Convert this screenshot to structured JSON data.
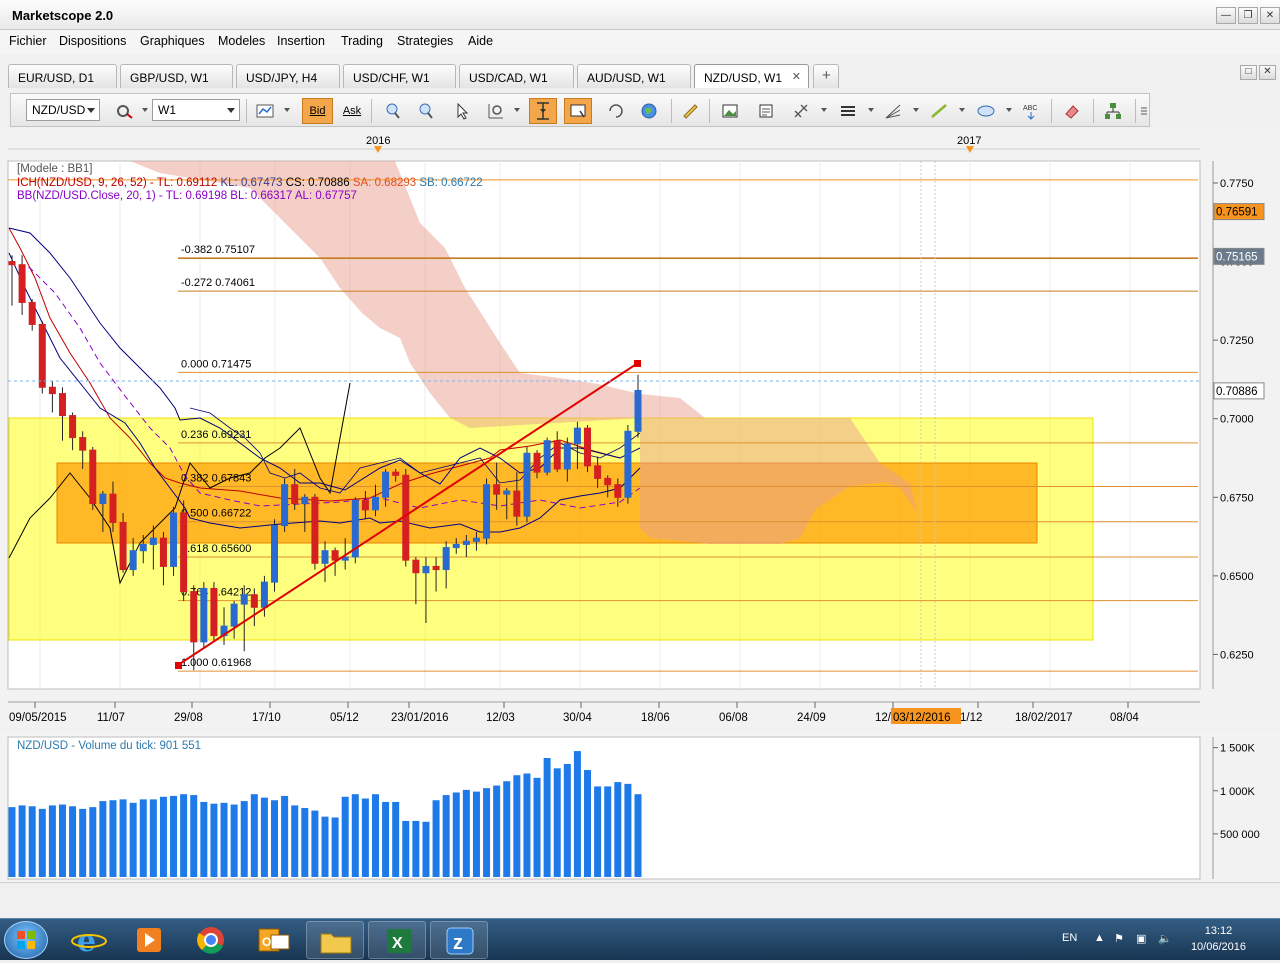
{
  "app": {
    "title": "Marketscope 2.0"
  },
  "menu": [
    "Fichier",
    "Dispositions",
    "Graphiques",
    "Modeles",
    "Insertion",
    "Trading",
    "Strategies",
    "Aide"
  ],
  "tabs": [
    "EUR/USD, D1",
    "GBP/USD, W1",
    "USD/JPY, H4",
    "USD/CHF, W1",
    "USD/CAD, W1",
    "AUD/USD, W1",
    "NZD/USD, W1"
  ],
  "active_tab": "NZD/USD, W1",
  "toolbar": {
    "symbol": "NZD/USD",
    "timeframe": "W1",
    "bid": "Bid",
    "ask": "Ask"
  },
  "chart": {
    "years": [
      "2016",
      "2017"
    ],
    "legend": {
      "model": "[Modele : BB1]",
      "ich": "ICH(NZD/USD, 9, 26, 52) -",
      "ich_tl": "TL: 0.69112",
      "ich_kl": "KL: 0.67473",
      "ich_cs": "CS: 0.70886",
      "ich_sa": "SA: 0.68293",
      "ich_sb": "SB: 0.66722",
      "bb": "BB(NZD/USD.Close, 20, 1) -",
      "bb_tl": "TL: 0.69198",
      "bb_bl": "BL: 0.66317",
      "bb_al": "AL: 0.67757"
    },
    "price_ticks": [
      "0.7750",
      "0.7500",
      "0.7250",
      "0.7000",
      "0.6750",
      "0.6500",
      "0.6250"
    ],
    "price_markers": [
      {
        "label": "0.76591",
        "bg": "#f7941d"
      },
      {
        "label": "0.75165",
        "bg": "#6b7b8b"
      },
      {
        "label": "0.70886",
        "bg": "#ffffff"
      }
    ],
    "fib_levels": [
      "-0.382 0.75107",
      "-0.272 0.74061",
      "0.000 0.71475",
      "0.236 0.69231",
      "0.382 0.67843",
      "0.500 0.66722",
      "0.618 0.65600",
      "0.764 0.64212",
      "1.000 0.61968"
    ],
    "date_ticks": [
      "09/05/2015",
      "11/07",
      "29/08",
      "17/10",
      "05/12",
      "23/01/2016",
      "12/03",
      "30/04",
      "18/06",
      "06/08",
      "24/09",
      "12/",
      "1/12",
      "18/02/2017",
      "08/04"
    ],
    "crosshair_date": "03/12/2016"
  },
  "volume": {
    "title": "NZD/USD - Volume du tick: 901 551",
    "ticks": [
      "1 500K",
      "1 000K",
      "500 000"
    ]
  },
  "chart_data": {
    "type": "candlestick",
    "symbol": "NZD/USD",
    "timeframe": "W1",
    "ylim": [
      0.614,
      0.782
    ],
    "candles": [
      {
        "o": 0.75,
        "h": 0.752,
        "l": 0.736,
        "c": 0.749
      },
      {
        "o": 0.749,
        "h": 0.752,
        "l": 0.733,
        "c": 0.737
      },
      {
        "o": 0.737,
        "h": 0.738,
        "l": 0.728,
        "c": 0.73
      },
      {
        "o": 0.73,
        "h": 0.731,
        "l": 0.708,
        "c": 0.71
      },
      {
        "o": 0.71,
        "h": 0.712,
        "l": 0.702,
        "c": 0.708
      },
      {
        "o": 0.708,
        "h": 0.71,
        "l": 0.693,
        "c": 0.701
      },
      {
        "o": 0.701,
        "h": 0.702,
        "l": 0.69,
        "c": 0.694
      },
      {
        "o": 0.694,
        "h": 0.696,
        "l": 0.684,
        "c": 0.69
      },
      {
        "o": 0.69,
        "h": 0.691,
        "l": 0.671,
        "c": 0.673
      },
      {
        "o": 0.673,
        "h": 0.677,
        "l": 0.664,
        "c": 0.676
      },
      {
        "o": 0.676,
        "h": 0.68,
        "l": 0.664,
        "c": 0.667
      },
      {
        "o": 0.667,
        "h": 0.67,
        "l": 0.651,
        "c": 0.652
      },
      {
        "o": 0.652,
        "h": 0.662,
        "l": 0.65,
        "c": 0.658
      },
      {
        "o": 0.658,
        "h": 0.663,
        "l": 0.654,
        "c": 0.66
      },
      {
        "o": 0.66,
        "h": 0.666,
        "l": 0.652,
        "c": 0.662
      },
      {
        "o": 0.662,
        "h": 0.664,
        "l": 0.647,
        "c": 0.653
      },
      {
        "o": 0.653,
        "h": 0.672,
        "l": 0.65,
        "c": 0.67
      },
      {
        "o": 0.67,
        "h": 0.674,
        "l": 0.642,
        "c": 0.645
      },
      {
        "o": 0.645,
        "h": 0.647,
        "l": 0.62,
        "c": 0.629
      },
      {
        "o": 0.629,
        "h": 0.648,
        "l": 0.627,
        "c": 0.646
      },
      {
        "o": 0.646,
        "h": 0.648,
        "l": 0.629,
        "c": 0.631
      },
      {
        "o": 0.631,
        "h": 0.64,
        "l": 0.628,
        "c": 0.634
      },
      {
        "o": 0.634,
        "h": 0.642,
        "l": 0.63,
        "c": 0.641
      },
      {
        "o": 0.641,
        "h": 0.647,
        "l": 0.626,
        "c": 0.644
      },
      {
        "o": 0.644,
        "h": 0.646,
        "l": 0.634,
        "c": 0.64
      },
      {
        "o": 0.64,
        "h": 0.65,
        "l": 0.637,
        "c": 0.648
      },
      {
        "o": 0.648,
        "h": 0.668,
        "l": 0.645,
        "c": 0.666
      },
      {
        "o": 0.666,
        "h": 0.681,
        "l": 0.664,
        "c": 0.679
      },
      {
        "o": 0.679,
        "h": 0.684,
        "l": 0.671,
        "c": 0.673
      },
      {
        "o": 0.673,
        "h": 0.676,
        "l": 0.664,
        "c": 0.675
      },
      {
        "o": 0.675,
        "h": 0.676,
        "l": 0.652,
        "c": 0.654
      },
      {
        "o": 0.654,
        "h": 0.661,
        "l": 0.648,
        "c": 0.658
      },
      {
        "o": 0.658,
        "h": 0.659,
        "l": 0.65,
        "c": 0.655
      },
      {
        "o": 0.655,
        "h": 0.662,
        "l": 0.652,
        "c": 0.656
      },
      {
        "o": 0.656,
        "h": 0.675,
        "l": 0.654,
        "c": 0.674
      },
      {
        "o": 0.674,
        "h": 0.677,
        "l": 0.668,
        "c": 0.671
      },
      {
        "o": 0.671,
        "h": 0.679,
        "l": 0.669,
        "c": 0.675
      },
      {
        "o": 0.675,
        "h": 0.684,
        "l": 0.672,
        "c": 0.683
      },
      {
        "o": 0.683,
        "h": 0.684,
        "l": 0.68,
        "c": 0.682
      },
      {
        "o": 0.682,
        "h": 0.684,
        "l": 0.653,
        "c": 0.655
      },
      {
        "o": 0.655,
        "h": 0.656,
        "l": 0.641,
        "c": 0.651
      },
      {
        "o": 0.651,
        "h": 0.656,
        "l": 0.635,
        "c": 0.653
      },
      {
        "o": 0.653,
        "h": 0.656,
        "l": 0.645,
        "c": 0.652
      },
      {
        "o": 0.652,
        "h": 0.661,
        "l": 0.646,
        "c": 0.659
      },
      {
        "o": 0.659,
        "h": 0.662,
        "l": 0.657,
        "c": 0.66
      },
      {
        "o": 0.66,
        "h": 0.663,
        "l": 0.656,
        "c": 0.661
      },
      {
        "o": 0.661,
        "h": 0.664,
        "l": 0.658,
        "c": 0.662
      },
      {
        "o": 0.662,
        "h": 0.681,
        "l": 0.66,
        "c": 0.679
      },
      {
        "o": 0.679,
        "h": 0.686,
        "l": 0.671,
        "c": 0.676
      },
      {
        "o": 0.676,
        "h": 0.678,
        "l": 0.668,
        "c": 0.677
      },
      {
        "o": 0.677,
        "h": 0.683,
        "l": 0.666,
        "c": 0.669
      },
      {
        "o": 0.669,
        "h": 0.691,
        "l": 0.667,
        "c": 0.689
      },
      {
        "o": 0.689,
        "h": 0.69,
        "l": 0.681,
        "c": 0.683
      },
      {
        "o": 0.683,
        "h": 0.694,
        "l": 0.682,
        "c": 0.693
      },
      {
        "o": 0.693,
        "h": 0.696,
        "l": 0.683,
        "c": 0.684
      },
      {
        "o": 0.684,
        "h": 0.694,
        "l": 0.68,
        "c": 0.692
      },
      {
        "o": 0.692,
        "h": 0.699,
        "l": 0.684,
        "c": 0.697
      },
      {
        "o": 0.697,
        "h": 0.698,
        "l": 0.683,
        "c": 0.685
      },
      {
        "o": 0.685,
        "h": 0.688,
        "l": 0.678,
        "c": 0.681
      },
      {
        "o": 0.681,
        "h": 0.682,
        "l": 0.675,
        "c": 0.679
      },
      {
        "o": 0.679,
        "h": 0.681,
        "l": 0.672,
        "c": 0.675
      },
      {
        "o": 0.675,
        "h": 0.698,
        "l": 0.673,
        "c": 0.696
      },
      {
        "o": 0.696,
        "h": 0.714,
        "l": 0.694,
        "c": 0.709
      }
    ],
    "volume": [
      810,
      830,
      820,
      790,
      830,
      840,
      820,
      790,
      810,
      880,
      890,
      900,
      860,
      900,
      900,
      930,
      940,
      960,
      950,
      870,
      850,
      860,
      840,
      880,
      960,
      920,
      890,
      940,
      830,
      800,
      770,
      700,
      690,
      930,
      960,
      910,
      960,
      870,
      870,
      650,
      650,
      640,
      890,
      950,
      980,
      1010,
      990,
      1030,
      1060,
      1110,
      1180,
      1200,
      1150,
      1380,
      1260,
      1310,
      1460,
      1240,
      1050,
      1050,
      1100,
      1080,
      960
    ]
  }
}
